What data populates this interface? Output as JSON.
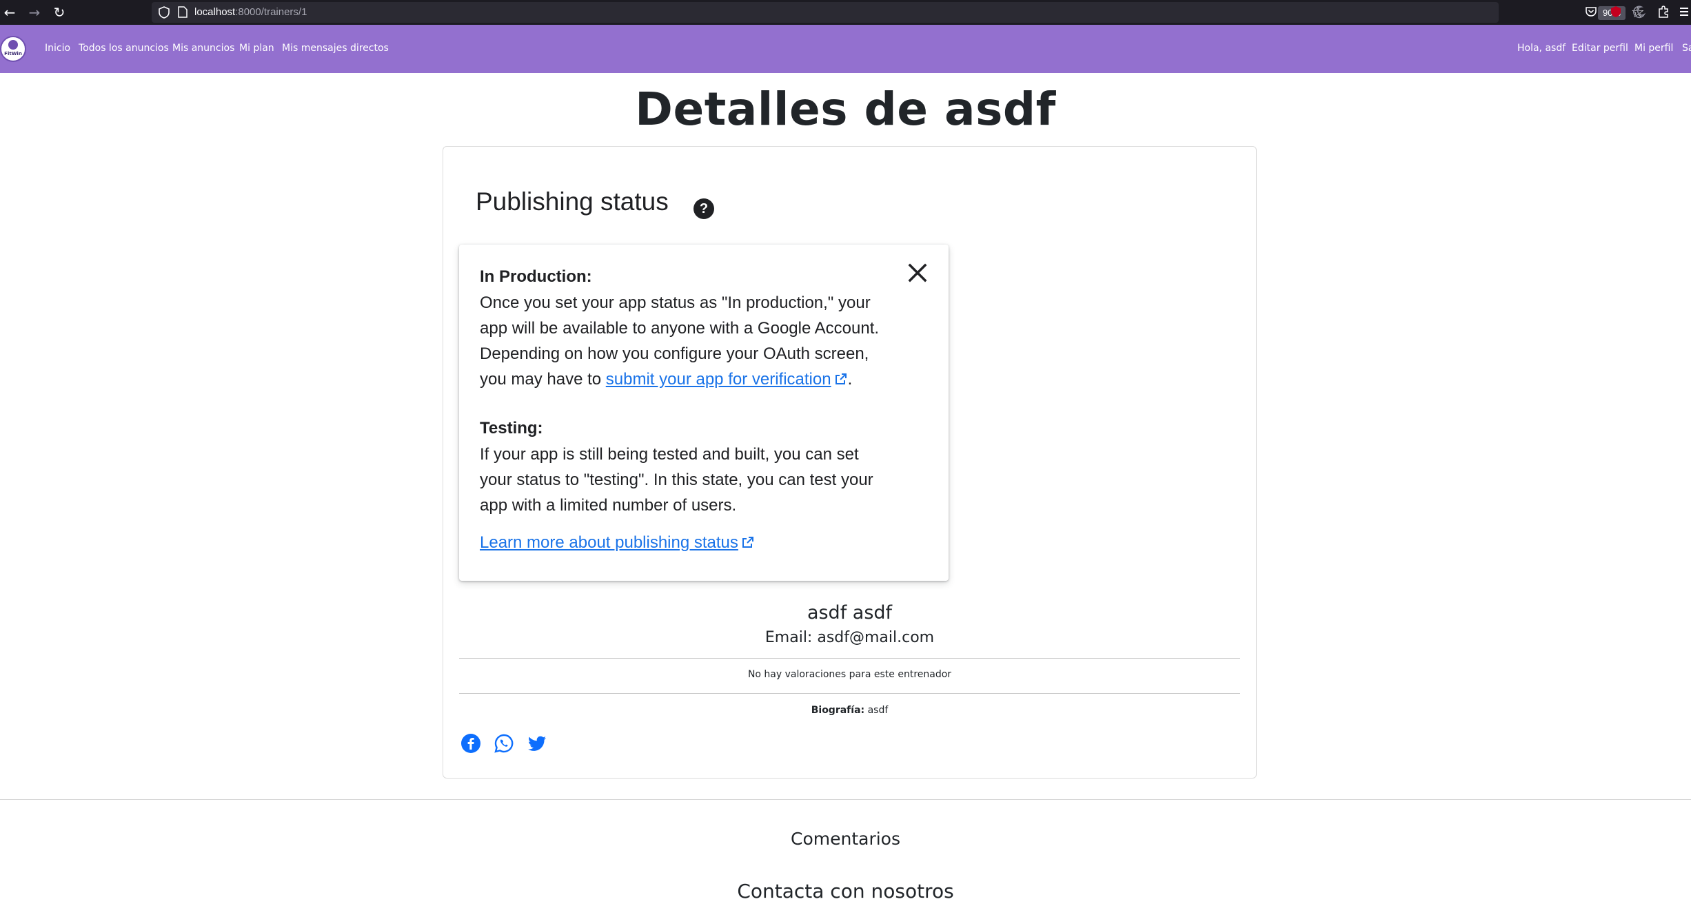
{
  "browser": {
    "url_host": "localhost",
    "url_path": ":8000/trainers/1",
    "zoom": "90%"
  },
  "navbar": {
    "logo_text": "FitWin",
    "left_links": [
      "Inicio",
      "Todos los anuncios",
      "Mis anuncios",
      "Mi plan",
      "Mis mensajes directos"
    ],
    "right_links": [
      "Hola, asdf",
      "Editar perfil",
      "Mi perfil",
      "Sa"
    ],
    "color": "#9370cf"
  },
  "page": {
    "title": "Detalles de asdf"
  },
  "card_image": {
    "heading": "Publishing status",
    "help_icon": "question-circle-icon",
    "production_title": "In Production:",
    "production_text_1": "Once you set your app status as \"In production,\" your app will be available to anyone with a Google Account. Depending on how you configure your OAuth screen, you may have to ",
    "production_link": "submit your app for verification",
    "production_text_2": ".",
    "testing_title": "Testing:",
    "testing_text": "If your app is still being tested and built, you can set your status to \"testing\". In this state, you can test your app with a limited number of users.",
    "learn_more_link": "Learn more about publishing status",
    "link_color": "#1a73e8"
  },
  "profile": {
    "name": "asdf asdf",
    "email": "Email: asdf@mail.com",
    "ratings": "No hay valoraciones para este entrenador",
    "bio_label": "Biografía:",
    "bio_value": "asdf",
    "social": [
      "facebook-icon",
      "whatsapp-icon",
      "twitter-icon"
    ],
    "social_color": "#0d6efd"
  },
  "footer": {
    "comments_title": "Comentarios",
    "contact_title": "Contacta con nosotros"
  }
}
